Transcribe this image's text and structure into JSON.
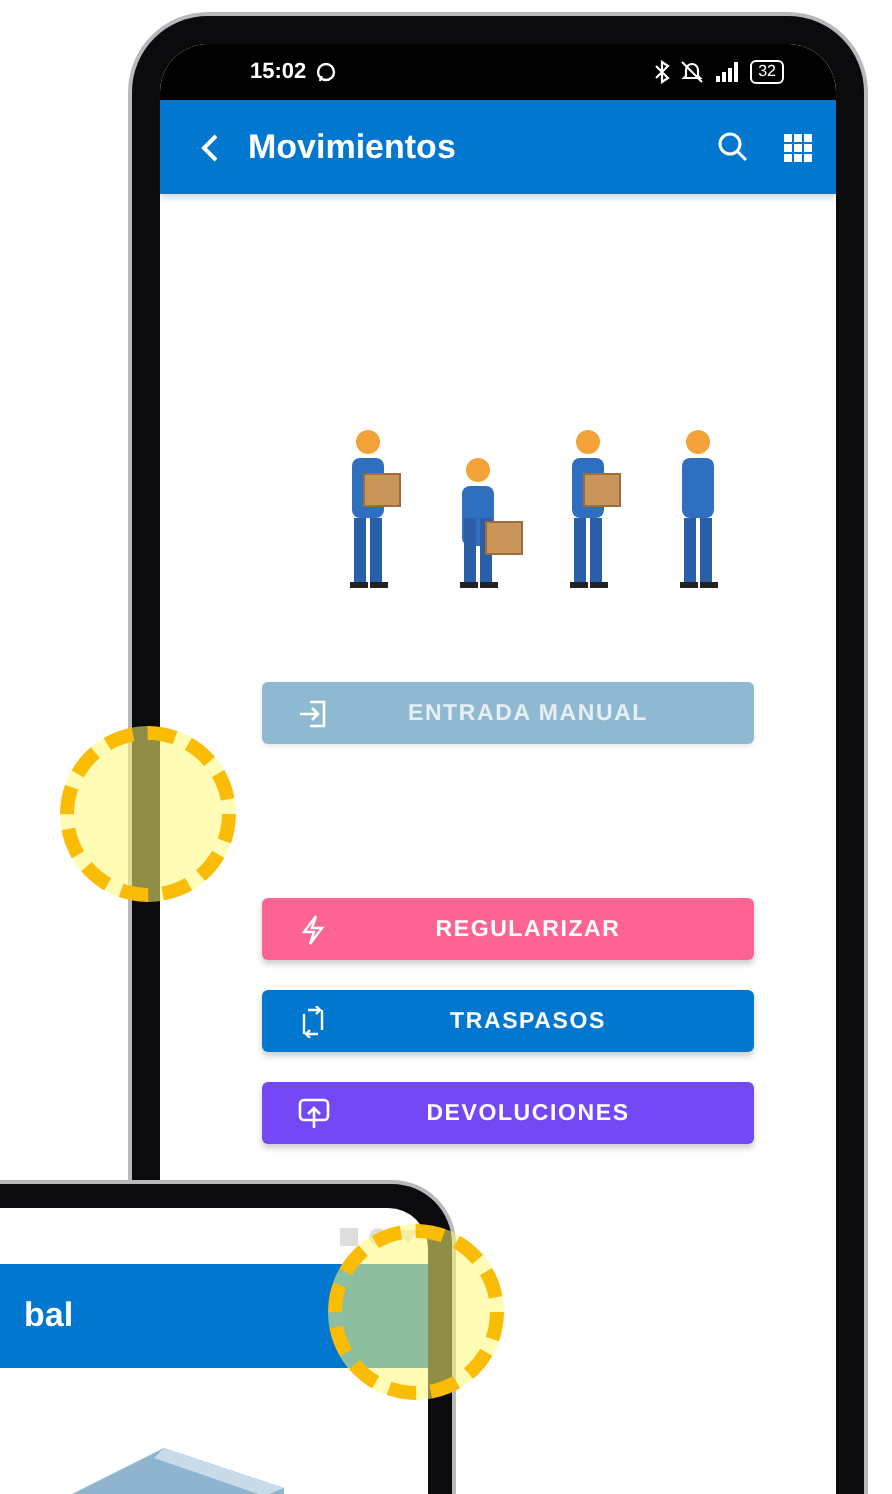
{
  "main_phone": {
    "status_bar": {
      "time": "15:02",
      "battery": "32"
    },
    "app_bar": {
      "title": "Movimientos"
    },
    "actions": [
      {
        "label": "ENTRADA MANUAL",
        "kind": "entry",
        "color": "#8fb9d1",
        "disabled": true
      },
      {
        "label": "REGULARIZAR",
        "kind": "adjust",
        "color": "#fd6493",
        "disabled": false
      },
      {
        "label": "TRASPASOS",
        "kind": "transfer",
        "color": "#0277cf",
        "disabled": false
      },
      {
        "label": "DEVOLUCIONES",
        "kind": "return",
        "color": "#7548f5",
        "disabled": false
      }
    ]
  },
  "second_phone": {
    "app_bar": {
      "title": "bal"
    }
  }
}
